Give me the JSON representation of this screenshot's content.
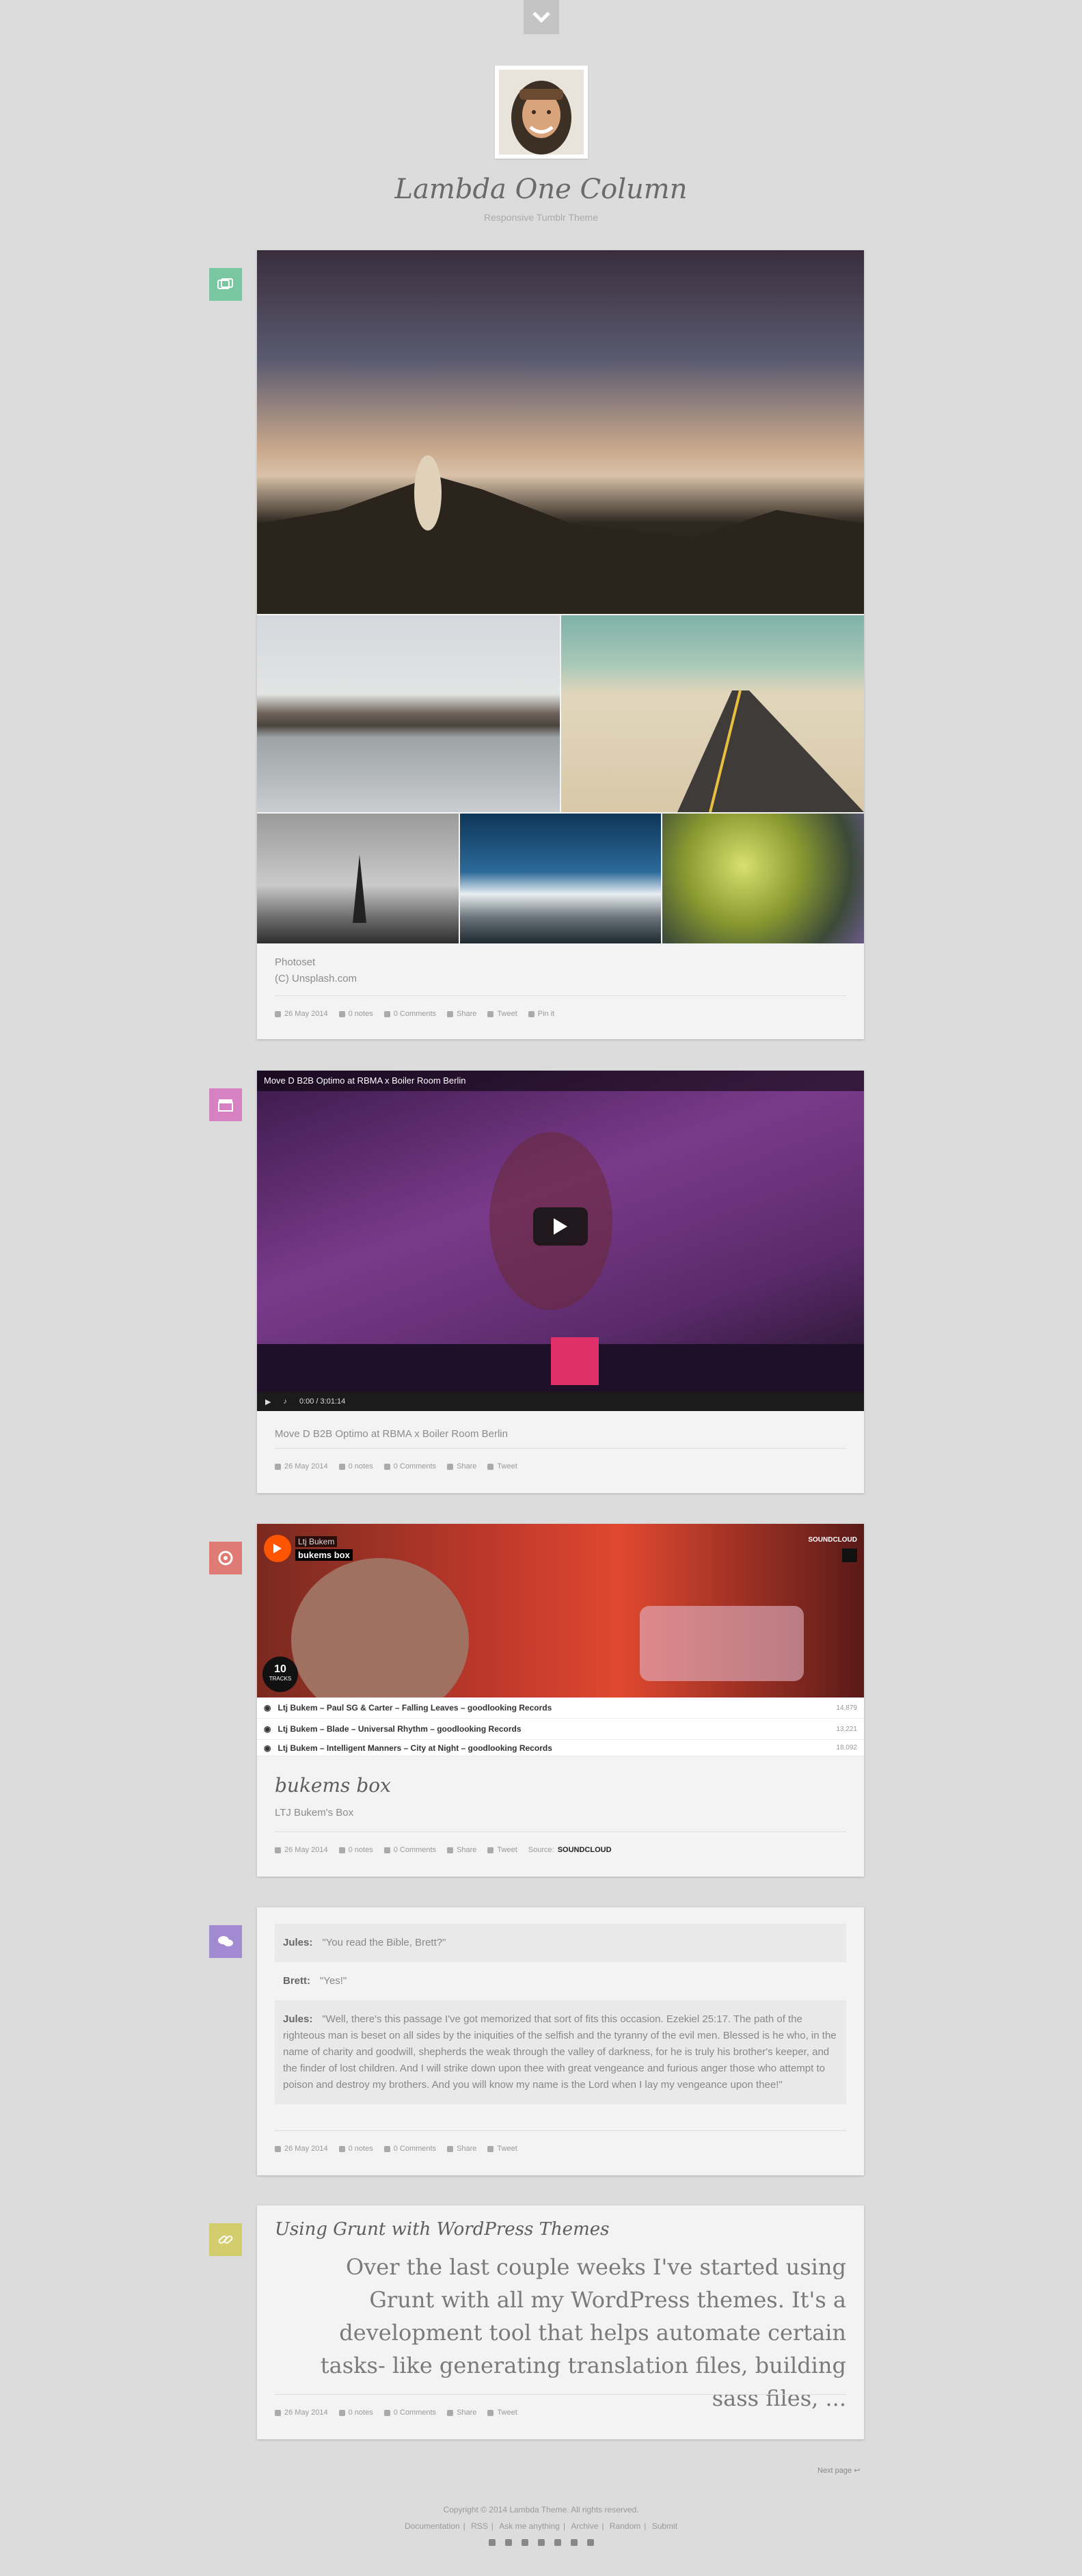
{
  "blog": {
    "title": "Lambda One Column",
    "description": "Responsive Tumblr Theme"
  },
  "colors": {
    "photoset": "#79c7a0",
    "video": "#d780c2",
    "audio": "#e07a74",
    "chat": "#a18ad2",
    "link": "#d3cd6e"
  },
  "photoset": {
    "caption_1": "Photoset",
    "caption_2": "(C) Unsplash.com",
    "meta": {
      "date": "26 May 2014",
      "notes": "0 notes",
      "comments": "0 Comments",
      "share": "Share",
      "tweet": "Tweet",
      "pin": "Pin it"
    }
  },
  "video": {
    "title": "Move D B2B Optimo at RBMA x Boiler Room Berlin",
    "time": "0:00 / 3:01:14",
    "caption": "Move D B2B Optimo at RBMA x Boiler Room Berlin",
    "meta": {
      "date": "26 May 2014",
      "notes": "0 notes",
      "comments": "0 Comments",
      "share": "Share",
      "tweet": "Tweet"
    }
  },
  "audio": {
    "artist": "Ltj Bukem",
    "set_name": "bukems box",
    "brand": "SOUNDCLOUD",
    "track_count": "10",
    "tracks_label": "TRACKS",
    "tracks": [
      {
        "name": "Ltj Bukem – Paul SG & Carter – Falling Leaves – goodlooking Records",
        "count": "14,879"
      },
      {
        "name": "Ltj Bukem – Blade – Universal Rhythm – goodlooking Records",
        "count": "13,221"
      },
      {
        "name": "Ltj Bukem – Intelligent Manners – City at Night – goodlooking Records",
        "count": "18,092"
      }
    ],
    "title": "bukems box",
    "caption": "LTJ Bukem's Box",
    "meta": {
      "date": "26 May 2014",
      "notes": "0 notes",
      "comments": "0 Comments",
      "share": "Share",
      "tweet": "Tweet",
      "source_label": "Source:",
      "source": "SOUNDCLOUD"
    }
  },
  "chat": {
    "lines": [
      {
        "speaker": "Jules:",
        "text": "\"You read the Bible, Brett?\""
      },
      {
        "speaker": "Brett:",
        "text": "\"Yes!\""
      },
      {
        "speaker": "Jules:",
        "text": "\"Well, there's this passage I've got memorized that sort of fits this occasion. Ezekiel 25:17. The path of the righteous man is beset on all sides by the iniquities of the selfish and the tyranny of the evil men. Blessed is he who, in the name of charity and goodwill, shepherds the weak through the valley of darkness, for he is truly his brother's keeper, and the finder of lost children. And I will strike down upon thee with great vengeance and furious anger those who attempt to poison and destroy my brothers. And you will know my name is the Lord when I lay my vengeance upon thee!\""
      }
    ],
    "meta": {
      "date": "26 May 2014",
      "notes": "0 notes",
      "comments": "0 Comments",
      "share": "Share",
      "tweet": "Tweet"
    }
  },
  "link": {
    "title": "Using Grunt with WordPress Themes",
    "excerpt": "Over the last couple weeks I've started using Grunt with all my WordPress themes. It's a development tool that helps automate certain tasks- like generating translation files, building sass files, ...",
    "meta": {
      "date": "26 May 2014",
      "notes": "0 notes",
      "comments": "0 Comments",
      "share": "Share",
      "tweet": "Tweet"
    }
  },
  "pagination": {
    "next": "Next page"
  },
  "footer": {
    "copyright": "Copyright © 2014 Lambda Theme. All rights reserved.",
    "links": [
      "Documentation",
      "RSS",
      "Ask me anything",
      "Archive",
      "Random",
      "Submit"
    ]
  }
}
